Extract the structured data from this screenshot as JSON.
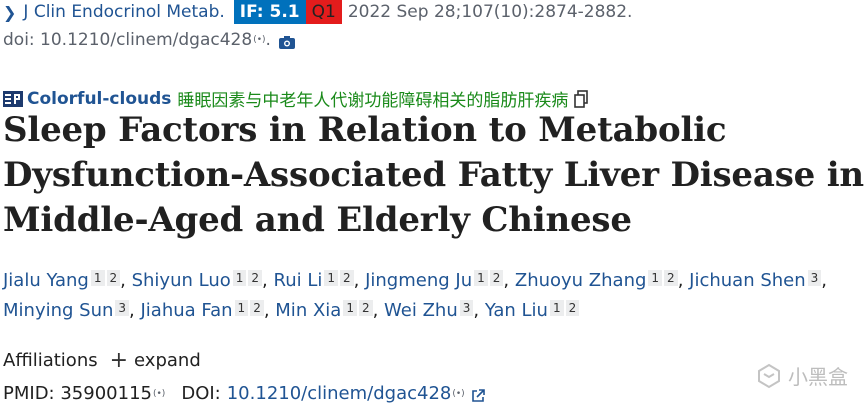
{
  "header": {
    "journal": "J Clin Endocrinol Metab.",
    "impact_factor": "IF: 5.1",
    "quartile": "Q1",
    "citation": "2022 Sep 28;107(10):2874-2882.",
    "doi_label": "doi: 10.1210/clinem/dgac428",
    "colors": {
      "link": "#205493",
      "if_badge": "#0071bc",
      "q_badge": "#e31c1c",
      "translation": "#1a8a1a"
    }
  },
  "translation": {
    "source": "Colorful-clouds",
    "chinese_title": "睡眠因素与中老年人代谢功能障碍相关的脂肪肝疾病",
    "icons": [
      "ep-logo-icon",
      "copy-icon"
    ]
  },
  "article": {
    "title": "Sleep Factors in Relation to Metabolic Dysfunction-Associated Fatty Liver Disease in Middle-Aged and Elderly Chinese"
  },
  "authors": [
    {
      "name": "Jialu Yang",
      "affils": [
        "1",
        "2"
      ]
    },
    {
      "name": "Shiyun Luo",
      "affils": [
        "1",
        "2"
      ]
    },
    {
      "name": "Rui Li",
      "affils": [
        "1",
        "2"
      ]
    },
    {
      "name": "Jingmeng Ju",
      "affils": [
        "1",
        "2"
      ]
    },
    {
      "name": "Zhuoyu Zhang",
      "affils": [
        "1",
        "2"
      ]
    },
    {
      "name": "Jichuan Shen",
      "affils": [
        "3"
      ]
    },
    {
      "name": "Minying Sun",
      "affils": [
        "3"
      ]
    },
    {
      "name": "Jiahua Fan",
      "affils": [
        "1",
        "2"
      ]
    },
    {
      "name": "Min Xia",
      "affils": [
        "1",
        "2"
      ]
    },
    {
      "name": "Wei Zhu",
      "affils": [
        "3"
      ]
    },
    {
      "name": "Yan Liu",
      "affils": [
        "1",
        "2"
      ]
    }
  ],
  "affiliations": {
    "label": "Affiliations",
    "expand_label": "expand"
  },
  "ids": {
    "pmid_label": "PMID:",
    "pmid": "35900115",
    "doi_label": "DOI:",
    "doi": "10.1210/clinem/dgac428"
  },
  "watermark": {
    "text": "小黑盒"
  }
}
